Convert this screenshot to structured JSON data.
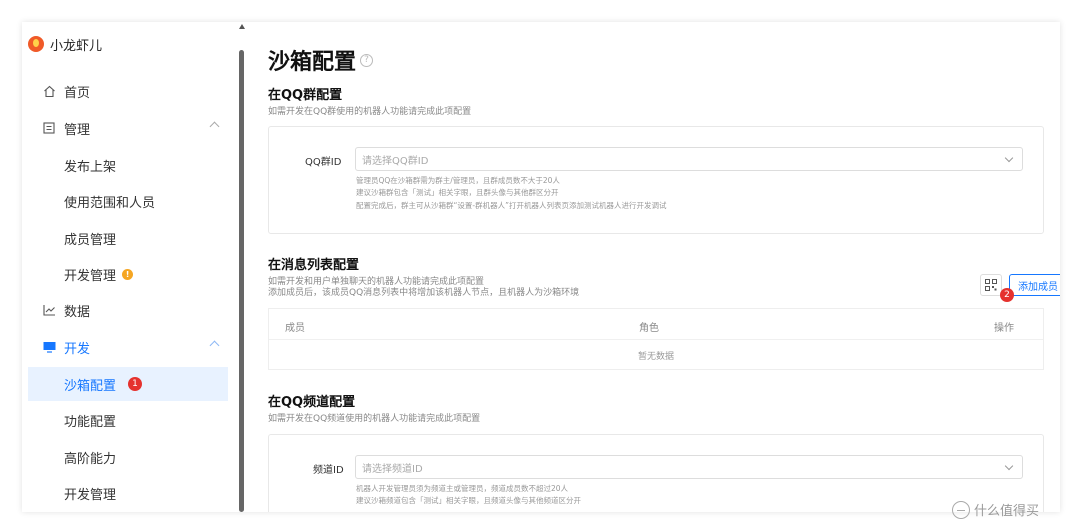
{
  "brand": {
    "name": "小龙虾儿"
  },
  "sidebar": {
    "items": [
      {
        "label": "首页",
        "icon": "home-icon"
      },
      {
        "label": "管理",
        "icon": "document-icon"
      },
      {
        "label": "发布上架"
      },
      {
        "label": "使用范围和人员"
      },
      {
        "label": "成员管理"
      },
      {
        "label": "开发管理",
        "badge": "!"
      },
      {
        "label": "数据",
        "icon": "chart-icon"
      },
      {
        "label": "开发",
        "icon": "monitor-icon"
      },
      {
        "label": "沙箱配置",
        "badge": "1"
      },
      {
        "label": "功能配置"
      },
      {
        "label": "高阶能力"
      },
      {
        "label": "开发管理"
      }
    ]
  },
  "page": {
    "title": "沙箱配置",
    "help": "?"
  },
  "group": {
    "title": "在QQ群配置",
    "desc": "如需开发在QQ群使用的机器人功能请完成此项配置",
    "field_label": "QQ群ID",
    "placeholder": "请选择QQ群ID",
    "hints": [
      "管理员QQ在沙箱群需为群主/管理员，且群成员数不大于20人",
      "建议沙箱群包含「测试」相关字眼，且群头像与其他群区分开",
      "配置完成后，群主可从沙箱群“设置-群机器人”打开机器人列表页添加测试机器人进行开发调试"
    ]
  },
  "message": {
    "title": "在消息列表配置",
    "desc1": "如需开发和用户单独聊天的机器人功能请完成此项配置",
    "desc2": "添加成员后，该成员QQ消息列表中将增加该机器人节点，且机器人为沙箱环境",
    "add_button": "添加成员",
    "badge": "2",
    "columns": [
      "成员",
      "角色",
      "操作"
    ],
    "empty": "暂无数据"
  },
  "channel": {
    "title": "在QQ频道配置",
    "desc": "如需开发在QQ频道使用的机器人功能请完成此项配置",
    "field_label": "频道ID",
    "placeholder": "请选择频道ID",
    "hints": [
      "机器人开发管理员须为频道主或管理员，频道成员数不超过20人",
      "建议沙箱频道包含「测试」相关字眼，且频道头像与其他频道区分开"
    ]
  },
  "watermark": {
    "text": "什么值得买"
  },
  "colors": {
    "accent": "#1677ff",
    "badge": "#e5322e",
    "warn": "#f5a623"
  }
}
